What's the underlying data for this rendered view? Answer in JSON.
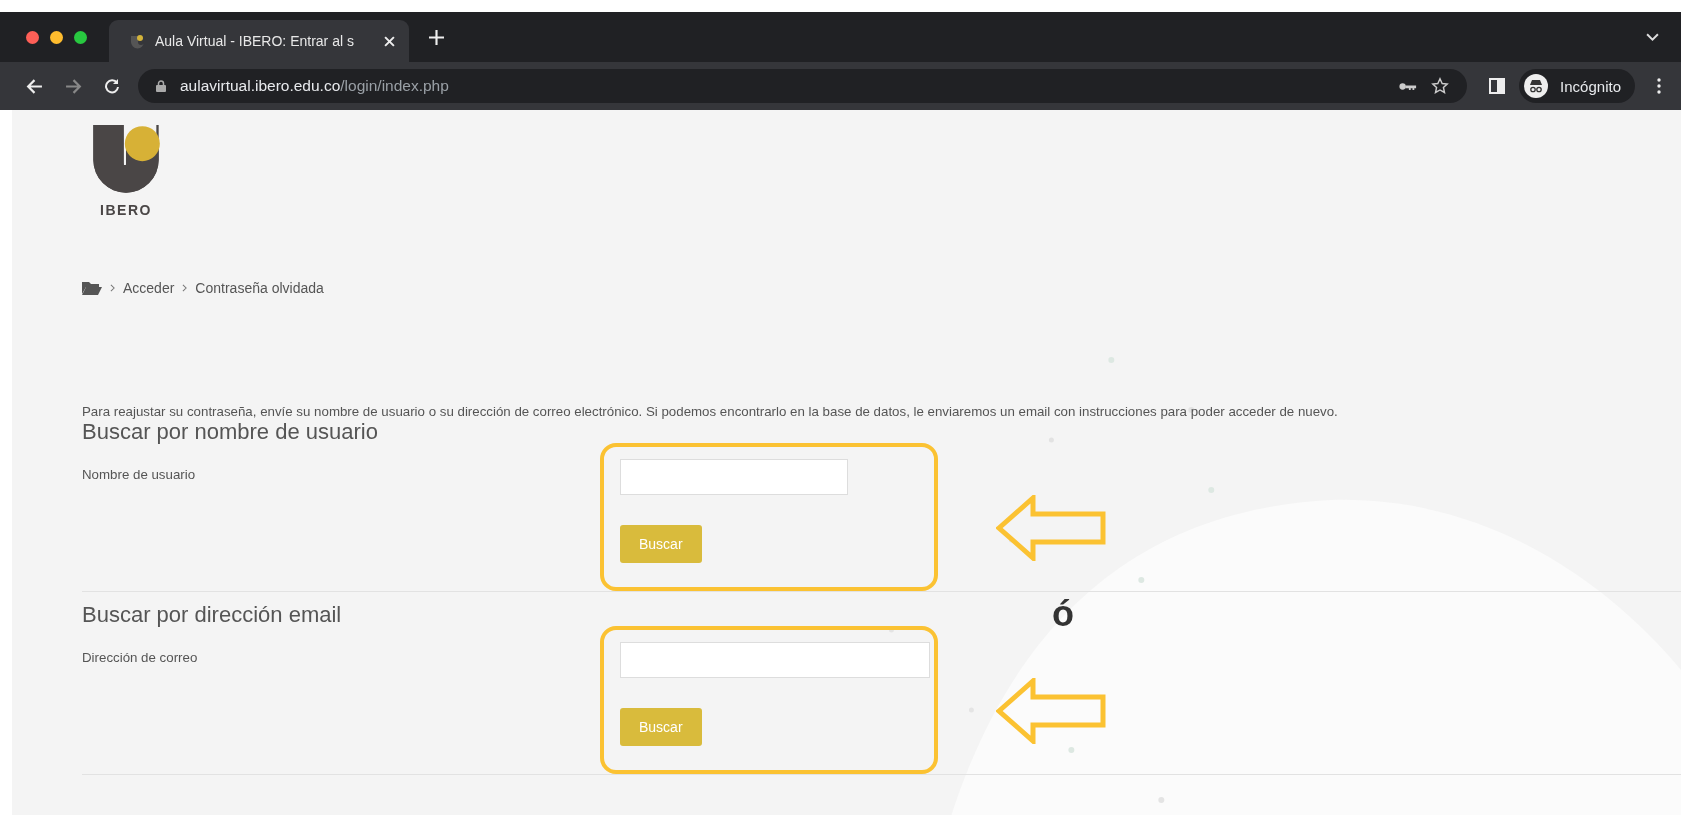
{
  "browser": {
    "tab": {
      "title": "Aula Virtual - IBERO: Entrar al s"
    },
    "address": {
      "domain": "aulavirtual.ibero.edu.co",
      "path": "/login/index.php"
    },
    "profile": "Incógnito"
  },
  "logo": {
    "text": "IBERO"
  },
  "breadcrumb": [
    "Acceder",
    "Contraseña olvidada"
  ],
  "instructions": "Para reajustar su contraseña, envíe su nombre de usuario o su dirección de correo electrónico. Si podemos encontrarlo en la base de datos, le enviaremos un email con instrucciones para poder acceder de nuevo.",
  "sections": [
    {
      "heading": "Buscar por nombre de usuario",
      "label": "Nombre de usuario",
      "button": "Buscar"
    },
    {
      "heading": "Buscar por dirección email",
      "label": "Dirección de correo",
      "button": "Buscar"
    }
  ],
  "annotation": {
    "separator": "ó"
  }
}
